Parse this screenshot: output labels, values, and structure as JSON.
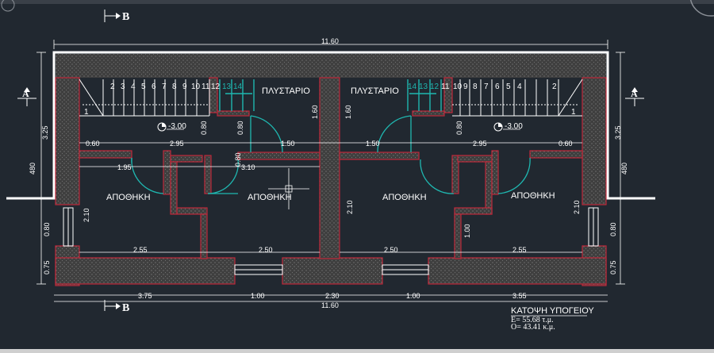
{
  "drawing": {
    "overall_width": "11.60",
    "depth": "480",
    "wing_depth": "3.25",
    "section_marker_top": "B",
    "section_marker_bottom": "B",
    "section_marker_left": "A",
    "section_marker_right": "A",
    "stair_steps_left": [
      "2",
      "3",
      "4",
      "5",
      "6",
      "7",
      "8",
      "9",
      "10",
      "11",
      "12",
      "13",
      "14"
    ],
    "stair_steps_right": [
      "14",
      "13",
      "12",
      "11",
      "10",
      "9",
      "8",
      "7",
      "6",
      "5",
      "4",
      "2"
    ],
    "stair_first_step": "1",
    "room_labels": {
      "pilot_left": "ΠΛΥΣΤΑΡΙΟ",
      "pilot_right": "ΠΛΥΣΤΑΡΙΟ",
      "storage_1": "ΑΠΟΘΗΚΗ",
      "storage_2": "ΑΠΟΘΗΚΗ",
      "storage_3": "ΑΠΟΘΗΚΗ",
      "storage_4": "ΑΠΟΘΗΚΗ"
    },
    "level": "-3.00",
    "dimensions": {
      "d060": "0.60",
      "d295": "2.95",
      "d080": "0.80",
      "d150": "1.50",
      "d160": "1.60",
      "d195": "1.95",
      "d310": "3.10",
      "d210": "2.10",
      "d255": "2.55",
      "d250": "2.50",
      "d075": "0.75",
      "d100": "1.00",
      "d375": "3.75",
      "d230": "2.30",
      "d355": "3.55"
    },
    "title": {
      "line1": "ΚΑΤΟΨΗ ΥΠΟΓΕΙΟΥ",
      "line2": "Ε= 55.68 τ.μ.",
      "line3": "Ο= 43.41 κ.μ."
    }
  }
}
